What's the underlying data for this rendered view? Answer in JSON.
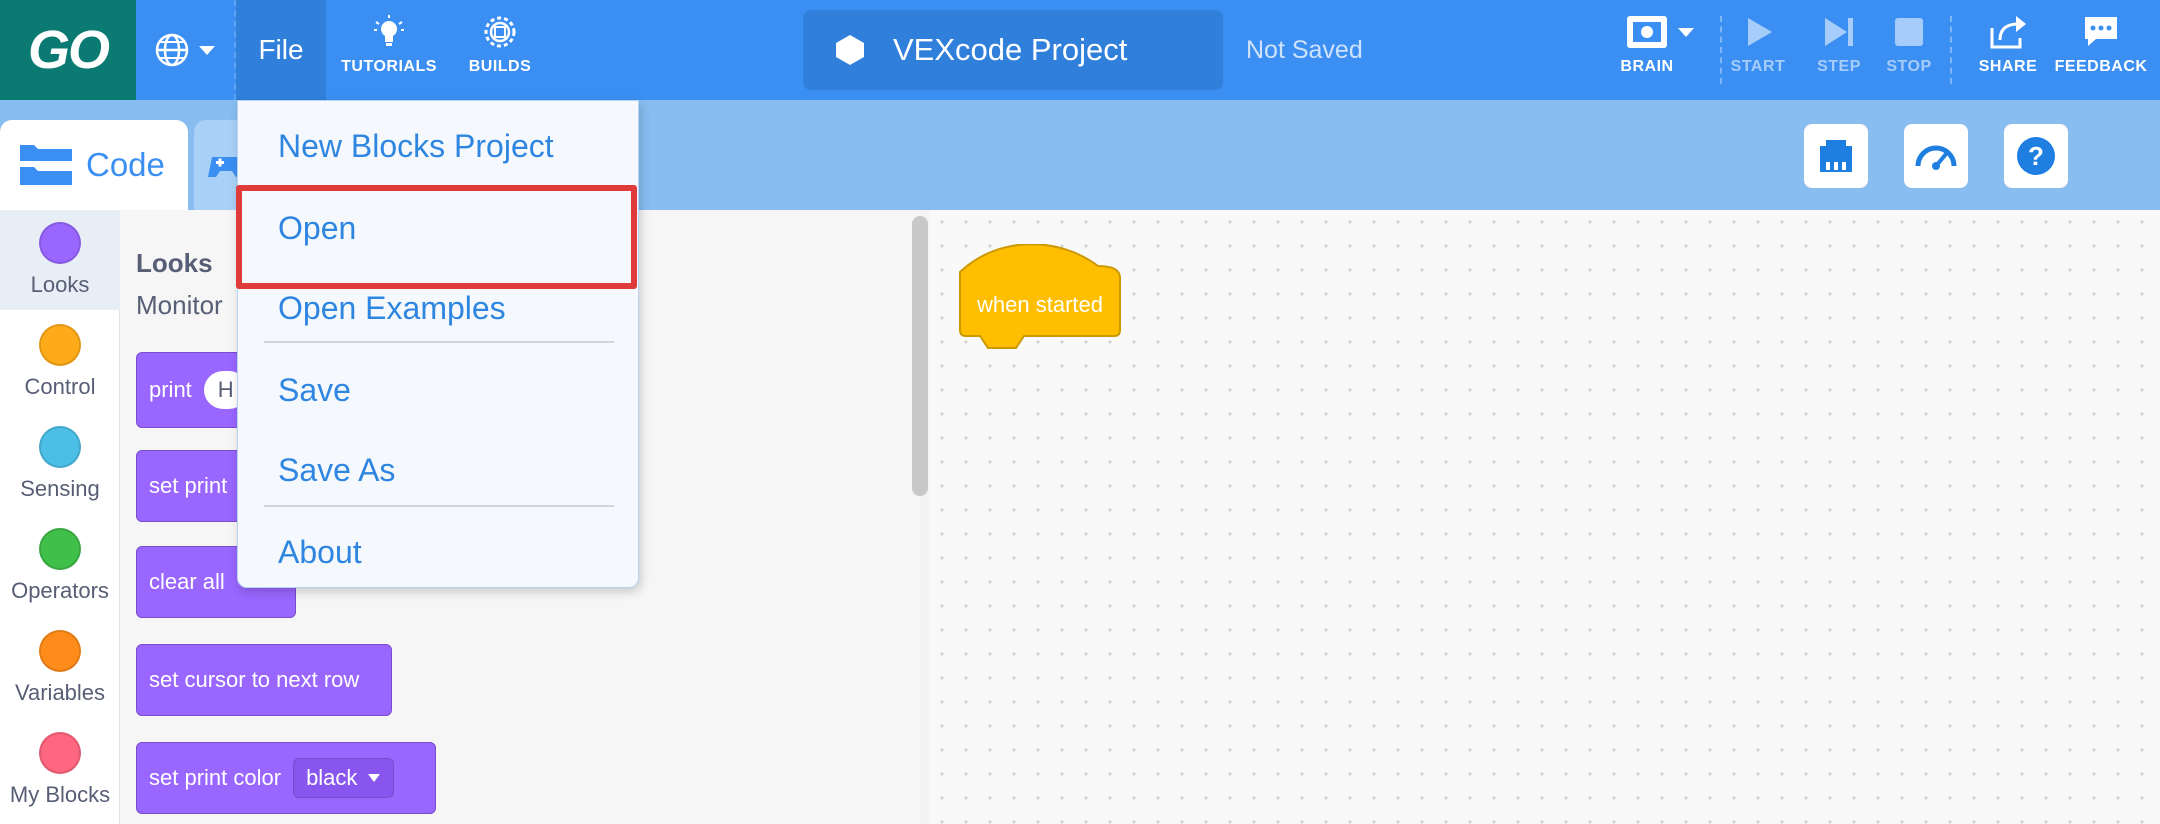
{
  "topbar": {
    "logo": "GO",
    "file_label": "File",
    "tutorials_label": "TUTORIALS",
    "builds_label": "BUILDS",
    "project_name": "VEXcode Project",
    "save_status": "Not Saved",
    "brain_label": "BRAIN",
    "start_label": "START",
    "step_label": "STEP",
    "stop_label": "STOP",
    "share_label": "SHARE",
    "feedback_label": "FEEDBACK"
  },
  "tabs": {
    "code_label": "Code"
  },
  "categories": [
    {
      "name": "Looks",
      "color": "#9966ff"
    },
    {
      "name": "Control",
      "color": "#ffab19"
    },
    {
      "name": "Sensing",
      "color": "#4cbfe6"
    },
    {
      "name": "Operators",
      "color": "#40bf4a"
    },
    {
      "name": "Variables",
      "color": "#ff8c1a"
    },
    {
      "name": "My Blocks",
      "color": "#ff6680"
    }
  ],
  "flyout": {
    "section_title": "Looks",
    "subsection": "Monitor",
    "blocks": {
      "print": "print",
      "print_value": "H",
      "set_print": "set print",
      "clear_all": "clear all",
      "set_cursor": "set cursor to next row",
      "set_print_color": "set print color",
      "color_value": "black"
    }
  },
  "workspace": {
    "hat_block": "when started"
  },
  "file_menu": {
    "items": [
      "New Blocks Project",
      "Open",
      "Open Examples",
      "Save",
      "Save As",
      "About"
    ]
  }
}
